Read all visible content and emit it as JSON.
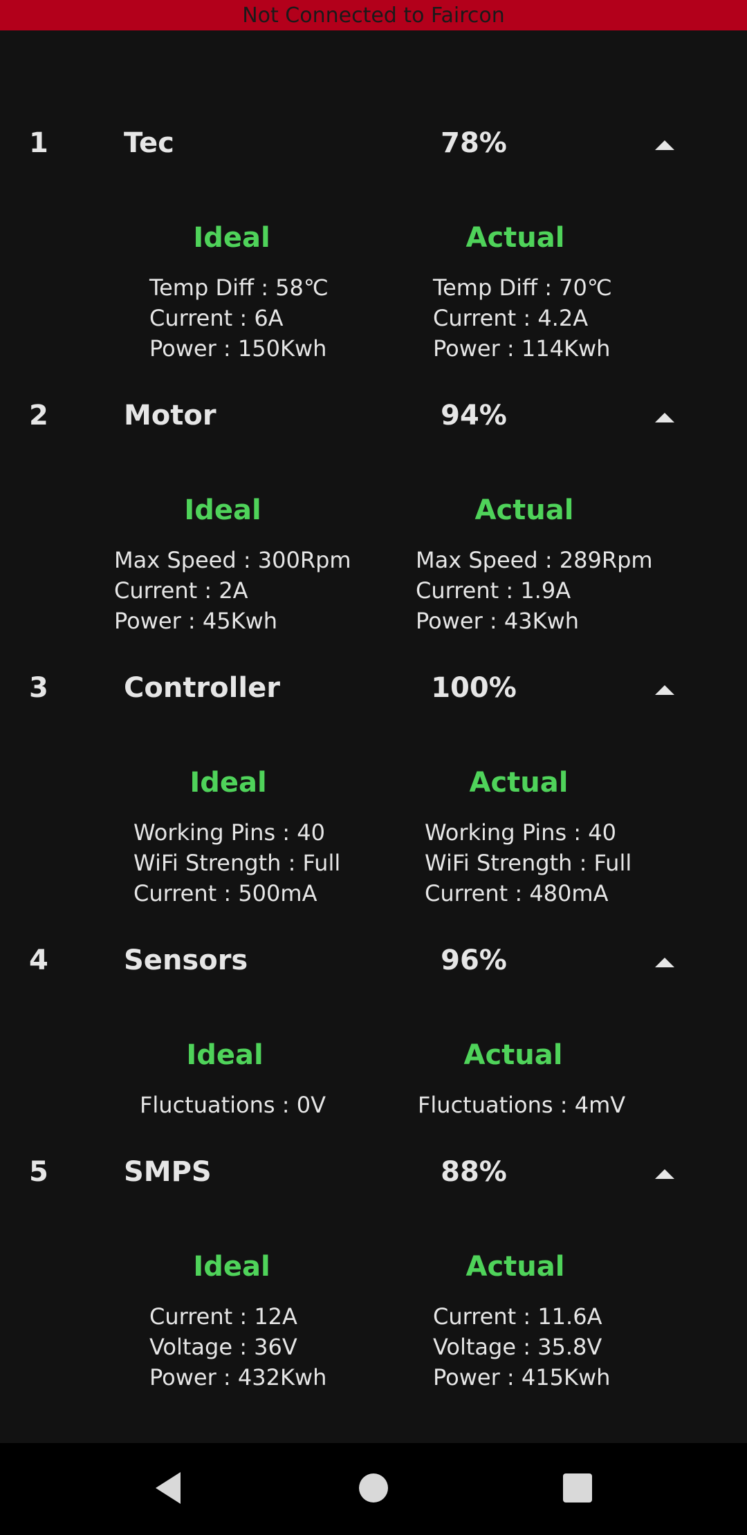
{
  "banner": {
    "text": "Not Connected to Faircon",
    "color": "#b3001b"
  },
  "accent_color": "#4fd35a",
  "sections": [
    {
      "index": "1",
      "name": "Tec",
      "percent": "78%",
      "toggle_icon": "chevron-up-icon",
      "ideal": {
        "label": "Ideal",
        "lines": [
          "Temp Diff : 58℃",
          "Current : 6A",
          "Power : 150Kwh"
        ]
      },
      "actual": {
        "label": "Actual",
        "lines": [
          "Temp Diff : 70℃",
          "Current : 4.2A",
          "Power : 114Kwh"
        ]
      }
    },
    {
      "index": "2",
      "name": "Motor",
      "percent": "94%",
      "toggle_icon": "chevron-up-icon",
      "ideal": {
        "label": "Ideal",
        "lines": [
          "Max Speed : 300Rpm",
          "Current : 2A",
          "Power : 45Kwh"
        ]
      },
      "actual": {
        "label": "Actual",
        "lines": [
          "Max Speed : 289Rpm",
          "Current : 1.9A",
          "Power : 43Kwh"
        ]
      }
    },
    {
      "index": "3",
      "name": "Controller",
      "percent": "100%",
      "toggle_icon": "chevron-up-icon",
      "ideal": {
        "label": "Ideal",
        "lines": [
          "Working Pins : 40",
          "WiFi Strength : Full",
          "Current : 500mA"
        ]
      },
      "actual": {
        "label": "Actual",
        "lines": [
          "Working Pins : 40",
          "WiFi Strength : Full",
          "Current : 480mA"
        ]
      }
    },
    {
      "index": "4",
      "name": "Sensors",
      "percent": "96%",
      "toggle_icon": "chevron-up-icon",
      "ideal": {
        "label": "Ideal",
        "lines": [
          "Fluctuations : 0V"
        ]
      },
      "actual": {
        "label": "Actual",
        "lines": [
          "Fluctuations : 4mV"
        ]
      }
    },
    {
      "index": "5",
      "name": "SMPS",
      "percent": "88%",
      "toggle_icon": "chevron-up-icon",
      "ideal": {
        "label": "Ideal",
        "lines": [
          "Current : 12A",
          "Voltage : 36V",
          "Power : 432Kwh"
        ]
      },
      "actual": {
        "label": "Actual",
        "lines": [
          "Current : 11.6A",
          "Voltage : 35.8V",
          "Power : 415Kwh"
        ]
      }
    }
  ],
  "navbar": {
    "back_icon": "back-triangle-icon",
    "home_icon": "home-circle-icon",
    "recents_icon": "recents-square-icon"
  }
}
